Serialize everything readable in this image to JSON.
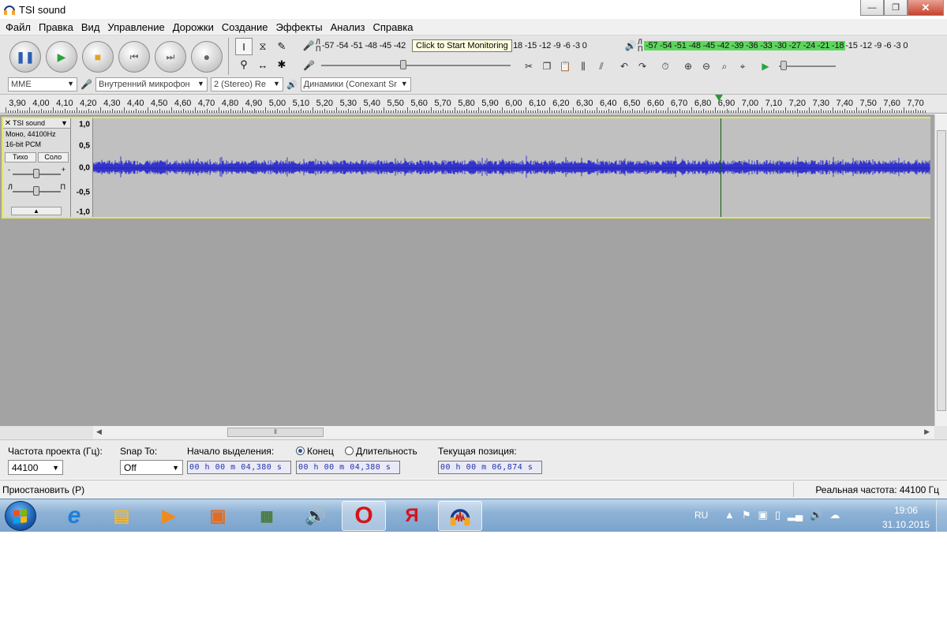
{
  "window": {
    "title": "TSI sound",
    "minimize": "—",
    "maximize": "❐",
    "close": "✕"
  },
  "menu": [
    "Файл",
    "Правка",
    "Вид",
    "Управление",
    "Дорожки",
    "Создание",
    "Эффекты",
    "Анализ",
    "Справка"
  ],
  "transport": {
    "pause": "❚❚",
    "play": "▶",
    "stop": "■",
    "skip_start": "⏮",
    "skip_end": "⏭",
    "record": "●"
  },
  "tools": [
    "I",
    "⧖",
    "✎",
    "⚲",
    "↔",
    "✱"
  ],
  "recording_meter": {
    "scale_left": "-57 -54 -51 -48 -45 -42",
    "tooltip": "Click to Start Monitoring",
    "scale_right": "18 -15 -12  -9  -6  -3  0"
  },
  "playback_meter": {
    "scale_green": "-57 -54 -51 -48 -45 -42 -39 -36 -33 -30 -27 -24 -21 -18",
    "scale_rest": "-15 -12  -9  -6  -3  0"
  },
  "devices": {
    "host": "MME",
    "input": "Внутренний микрофон",
    "channels": "2 (Stereo) Re",
    "output": "Динамики (Conexant Sr"
  },
  "ruler": {
    "labels": [
      "3,90",
      "4,00",
      "4,10",
      "4,20",
      "4,30",
      "4,40",
      "4,50",
      "4,60",
      "4,70",
      "4,80",
      "4,90",
      "5,00",
      "5,10",
      "5,20",
      "5,30",
      "5,40",
      "5,50",
      "5,60",
      "5,70",
      "5,80",
      "5,90",
      "6,00",
      "6,10",
      "6,20",
      "6,30",
      "6,40",
      "6,50",
      "6,60",
      "6,70",
      "6,80",
      "6,90",
      "7,00",
      "7,10",
      "7,20",
      "7,30",
      "7,40",
      "7,50",
      "7,60",
      "7,70"
    ],
    "playhead": "6,874"
  },
  "track": {
    "name": "TSI sound",
    "close": "✕",
    "dropdown": "▼",
    "format_line1": "Моно, 44100Hz",
    "format_line2": "16-bit PCM",
    "mute": "Тихо",
    "solo": "Соло",
    "gain_minus": "-",
    "gain_plus": "+",
    "pan_left": "Л",
    "pan_right": "П",
    "collapse": "▲",
    "scale": [
      "1,0",
      "0,5",
      "0,0",
      "-0,5",
      "-1,0"
    ]
  },
  "selection": {
    "rate_label": "Частота проекта (Гц):",
    "rate_value": "44100",
    "snap_label": "Snap To:",
    "snap_value": "Off",
    "start_label": "Начало выделения:",
    "start_value": "00 h 00 m 04,380 s",
    "end_radio": "Конец",
    "length_radio": "Длительность",
    "end_value": "00 h 00 m 04,380 s",
    "position_label": "Текущая позиция:",
    "position_value": "00 h 00 m 06,874 s"
  },
  "status": {
    "left": "Приостановить (P)",
    "right": "Реальная частота: 44100 Гц"
  },
  "taskbar": {
    "apps": [
      "Internet Explorer",
      "Проводник",
      "Медиаплеер",
      "Офис",
      "Фото",
      "Звук",
      "Opera",
      "Яндекс",
      "Audacity"
    ],
    "opera_glyph": "O",
    "yandex_glyph": "Я",
    "lang": "RU",
    "time": "19:06",
    "date": "31.10.2015"
  },
  "colors": {
    "waveform": "#3333cc",
    "track_border": "#e3e36a",
    "playhead": "#2c9a2c",
    "meter_green": "#5ed65e"
  }
}
